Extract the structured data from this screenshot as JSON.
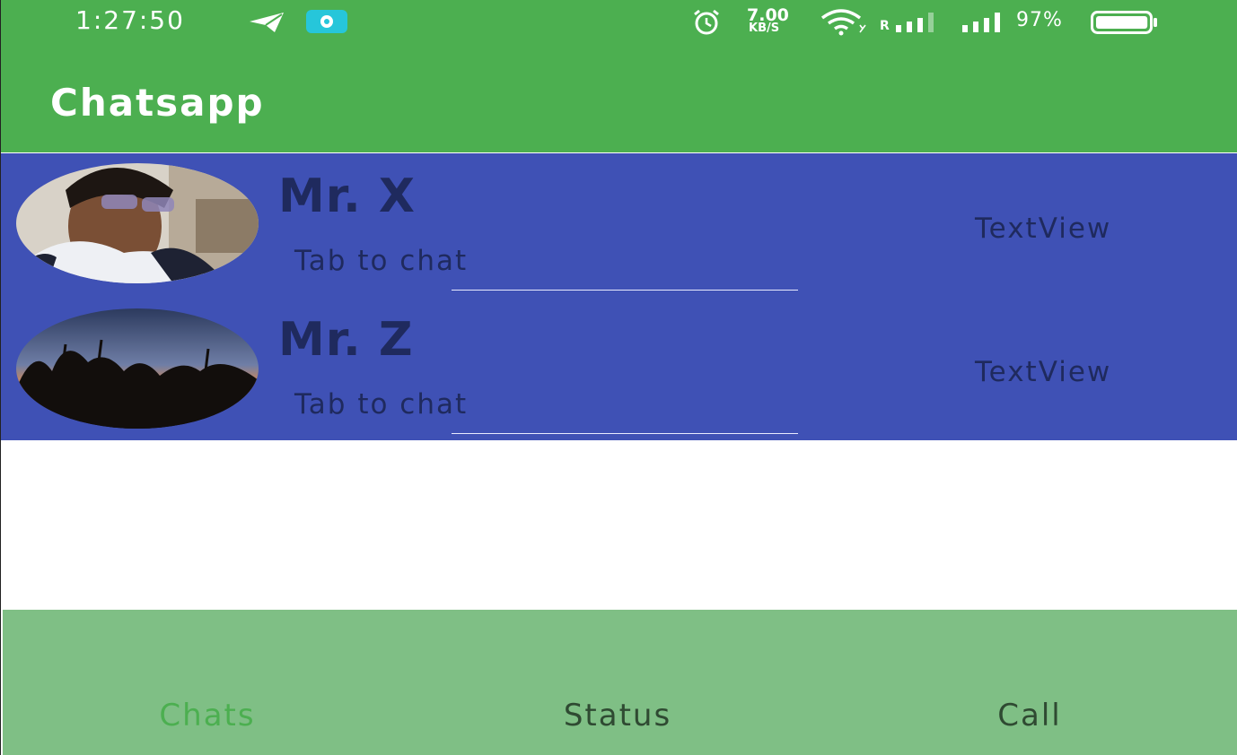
{
  "status_bar": {
    "time": "1:27:50",
    "speed_value": "7.00",
    "speed_unit": "KB/S",
    "roaming_label": "R",
    "battery_percent": "97%",
    "battery_level": 0.97,
    "icons": [
      "telegram-icon",
      "notification-app-icon",
      "alarm-icon",
      "wifi-icon",
      "signal-icon",
      "battery-icon"
    ]
  },
  "app_bar": {
    "title": "Chatsapp",
    "color": "#4caf50"
  },
  "chats": [
    {
      "name": "Mr. X",
      "subtitle": "Tab to chat",
      "time_label": "TextView",
      "avatar": "person-photo"
    },
    {
      "name": "Mr. Z",
      "subtitle": "Tab to chat",
      "time_label": "TextView",
      "avatar": "sunset-trees-photo"
    }
  ],
  "list_background": "#3f51b5",
  "bottom_nav": {
    "tabs": [
      {
        "label": "Chats",
        "active": true
      },
      {
        "label": "Status",
        "active": false
      },
      {
        "label": "Call",
        "active": false
      }
    ],
    "background": "#7fbf85",
    "active_color": "#4caf50",
    "inactive_color": "#2f4a32"
  }
}
